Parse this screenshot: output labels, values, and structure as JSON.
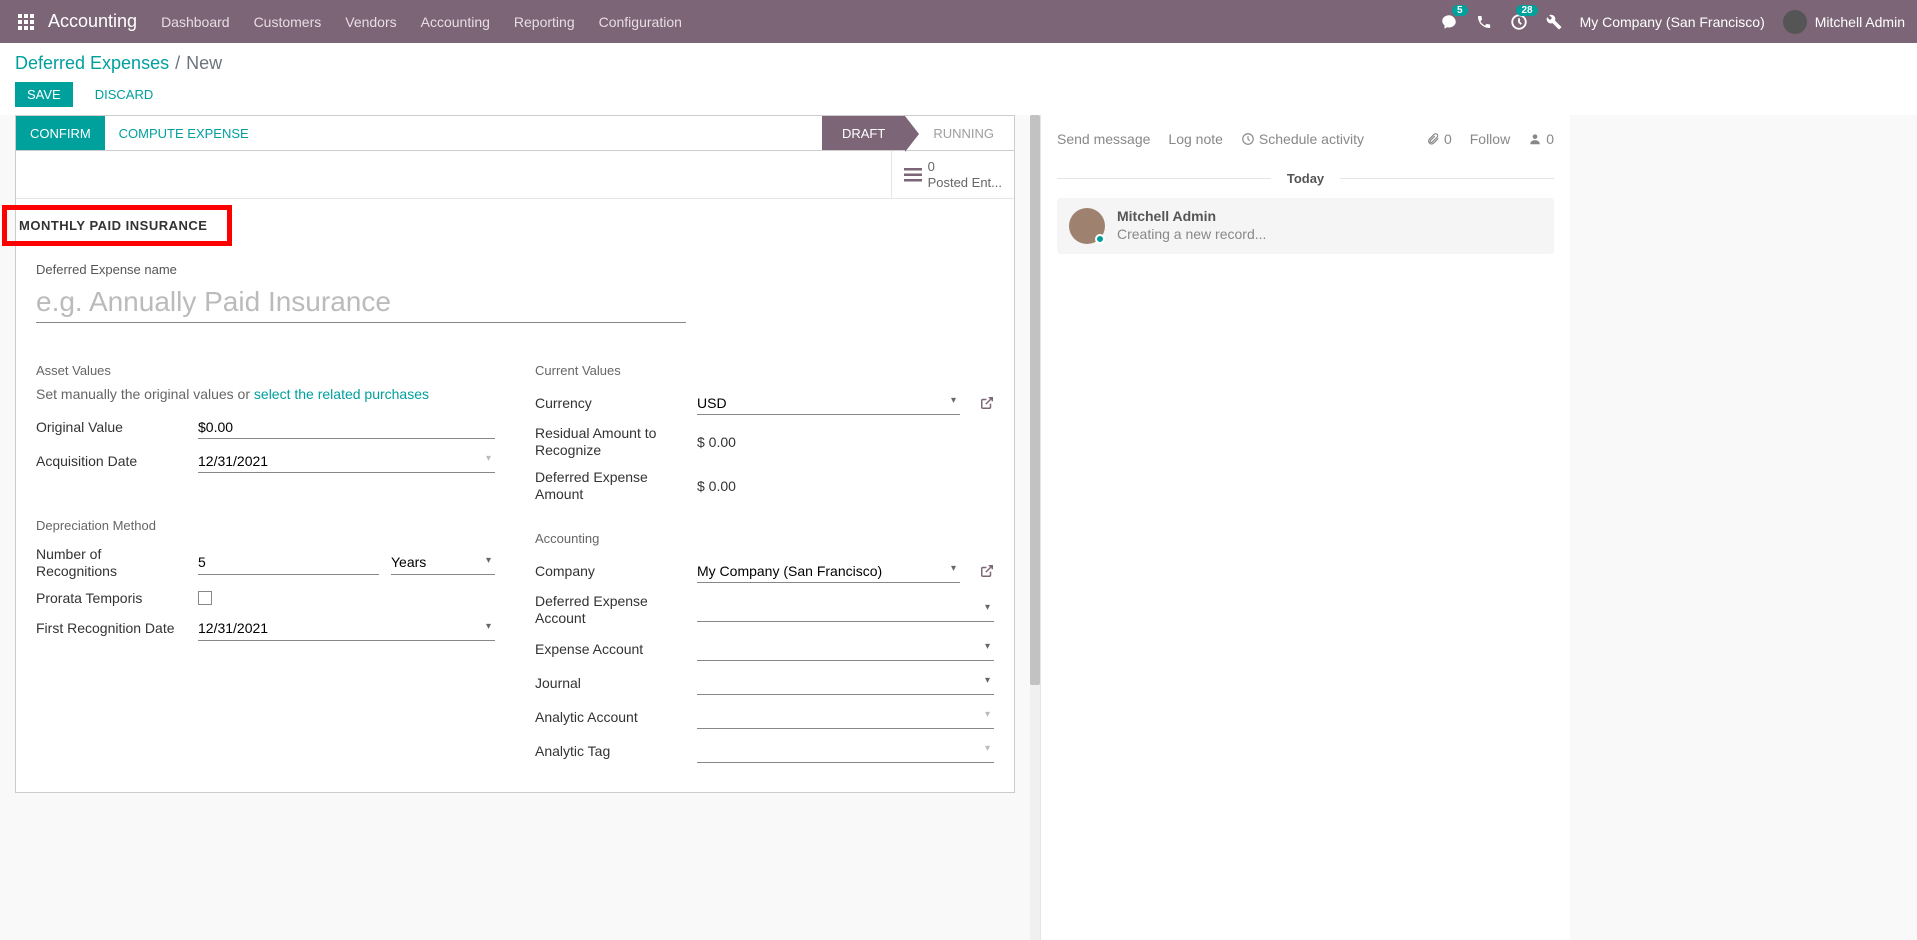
{
  "navbar": {
    "app_title": "Accounting",
    "menu": [
      "Dashboard",
      "Customers",
      "Vendors",
      "Accounting",
      "Reporting",
      "Configuration"
    ],
    "chat_badge": "5",
    "activity_badge": "28",
    "company": "My Company (San Francisco)",
    "user": "Mitchell Admin"
  },
  "control": {
    "breadcrumb_root": "Deferred Expenses",
    "breadcrumb_sep": "/",
    "breadcrumb_current": "New",
    "save": "SAVE",
    "discard": "DISCARD"
  },
  "statusbar": {
    "confirm": "CONFIRM",
    "compute": "COMPUTE EXPENSE",
    "draft": "DRAFT",
    "running": "RUNNING"
  },
  "buttonbox": {
    "posted_count": "0",
    "posted_label": "Posted Ent..."
  },
  "form": {
    "model_title": "MONTHLY PAID INSURANCE",
    "name_label": "Deferred Expense name",
    "name_placeholder": "e.g. Annually Paid Insurance",
    "asset_values": "Asset Values",
    "hint_pre": "Set manually the original values or ",
    "hint_link": "select the related purchases",
    "original_value_label": "Original Value",
    "original_value": "$0.00",
    "acq_date_label": "Acquisition Date",
    "acq_date": "12/31/2021",
    "current_values": "Current Values",
    "currency_label": "Currency",
    "currency": "USD",
    "residual_label": "Residual Amount to Recognize",
    "residual": "$ 0.00",
    "def_exp_amt_label": "Deferred Expense Amount",
    "def_exp_amt": "$ 0.00",
    "dep_method": "Depreciation Method",
    "num_recog_label": "Number of Recognitions",
    "num_recog": "5",
    "num_recog_unit": "Years",
    "prorata_label": "Prorata Temporis",
    "first_recog_label": "First Recognition Date",
    "first_recog": "12/31/2021",
    "accounting_section": "Accounting",
    "company_label": "Company",
    "company": "My Company (San Francisco)",
    "def_account_label": "Deferred Expense Account",
    "exp_account_label": "Expense Account",
    "journal_label": "Journal",
    "analytic_account_label": "Analytic Account",
    "analytic_tag_label": "Analytic Tag"
  },
  "chatter": {
    "send": "Send message",
    "log": "Log note",
    "schedule": "Schedule activity",
    "attach_count": "0",
    "follow": "Follow",
    "follower_count": "0",
    "today": "Today",
    "msg_author": "Mitchell Admin",
    "msg_text": "Creating a new record..."
  }
}
